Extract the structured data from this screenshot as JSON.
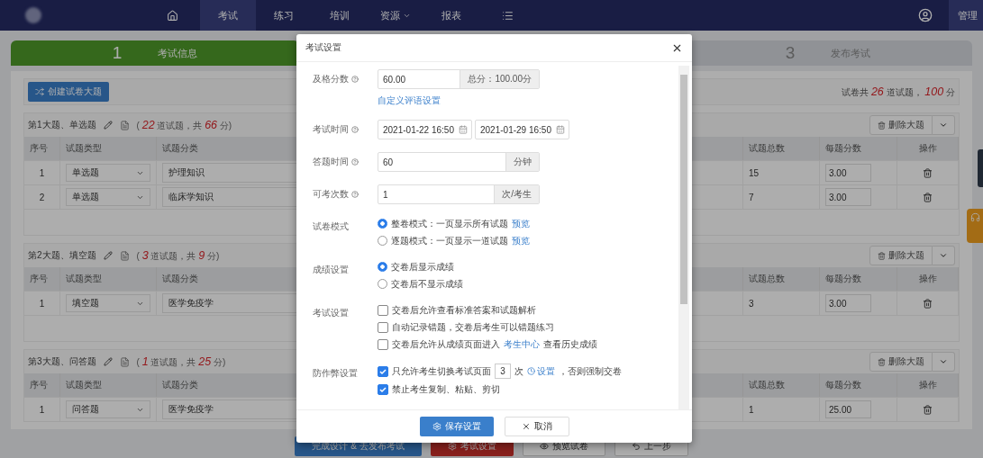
{
  "nav": {
    "items": [
      {
        "kind": "home",
        "selected": false
      },
      {
        "kind": "text",
        "label": "考试",
        "selected": true
      },
      {
        "kind": "text",
        "label": "练习",
        "selected": false
      },
      {
        "kind": "text",
        "label": "培训",
        "selected": false
      },
      {
        "kind": "dropdown",
        "label": "资源",
        "selected": false
      },
      {
        "kind": "text",
        "label": "报表",
        "selected": false
      },
      {
        "kind": "list",
        "selected": false
      }
    ],
    "user": "管理"
  },
  "steps": [
    {
      "number": "1",
      "label": "考试信息",
      "selected": true
    },
    {
      "number": "3",
      "label": "发布考试",
      "selected": false
    }
  ],
  "create_button": "创建试卷大题",
  "summary": {
    "prefix": "试卷共",
    "count": "26",
    "middle": "道试题，",
    "score": "100",
    "suffix": "分"
  },
  "sections": [
    {
      "title": "第1大题、单选题",
      "summary": {
        "prefix": "(",
        "count": "22",
        "middle": "道试题，共",
        "score": "66",
        "suffix": "分)"
      },
      "delete_label": "删除大题",
      "columns": [
        "序号",
        "试题类型",
        "试题分类",
        "试题总数",
        "每题分数",
        "操作"
      ],
      "rows": [
        {
          "index": "1",
          "type": "单选题",
          "category": "护理知识",
          "total": "15",
          "per_score": "3.00"
        },
        {
          "index": "2",
          "type": "单选题",
          "category": "临床学知识",
          "total": "7",
          "per_score": "3.00"
        }
      ]
    },
    {
      "title": "第2大题、填空题",
      "summary": {
        "prefix": "(",
        "count": "3",
        "middle": "道试题，共",
        "score": "9",
        "suffix": "分)"
      },
      "delete_label": "删除大题",
      "columns": [
        "序号",
        "试题类型",
        "试题分类",
        "试题总数",
        "每题分数",
        "操作"
      ],
      "rows": [
        {
          "index": "1",
          "type": "填空题",
          "category": "医学免疫学",
          "total": "3",
          "per_score": "3.00"
        }
      ]
    },
    {
      "title": "第3大题、问答题",
      "summary": {
        "prefix": "(",
        "count": "1",
        "middle": "道试题，共",
        "score": "25",
        "suffix": "分)"
      },
      "delete_label": "删除大题",
      "columns": [
        "序号",
        "试题类型",
        "试题分类",
        "试题总数",
        "每题分数",
        "操作"
      ],
      "rows": [
        {
          "index": "1",
          "type": "问答题",
          "category": "医学免疫学",
          "total": "1",
          "per_score": "25.00"
        }
      ]
    }
  ],
  "bottom_buttons": [
    {
      "kind": "primary",
      "label": "完成设计 & 去发布考试"
    },
    {
      "kind": "settings",
      "label": "考试设置"
    },
    {
      "kind": "preview",
      "label": "预览试卷"
    },
    {
      "kind": "back",
      "label": "上一步"
    }
  ],
  "modal": {
    "title": "考试设置",
    "fields": [
      {
        "kind": "addon",
        "label": "及格分数",
        "help": true,
        "value": "60.00",
        "addon": "总分：100.00分",
        "link": "自定义评语设置"
      },
      {
        "kind": "daterange",
        "label": "考试时间",
        "help": true,
        "start": "2021-01-22 16:50",
        "end": "2021-01-29 16:50"
      },
      {
        "kind": "addon",
        "label": "答题时间",
        "help": true,
        "value": "60",
        "addon": "分钟"
      },
      {
        "kind": "addon",
        "label": "可考次数",
        "help": true,
        "value": "1",
        "addon": "次/考生"
      },
      {
        "kind": "radio",
        "label": "试卷模式",
        "options": [
          {
            "selected": true,
            "parts": [
              {
                "kind": "text",
                "text": "整卷模式：一页显示所有试题"
              },
              {
                "kind": "link",
                "text": "预览"
              }
            ]
          },
          {
            "selected": false,
            "parts": [
              {
                "kind": "text",
                "text": "逐题模式：一页显示一道试题"
              },
              {
                "kind": "link",
                "text": "预览"
              }
            ]
          }
        ]
      },
      {
        "kind": "radio",
        "label": "成绩设置",
        "options": [
          {
            "selected": true,
            "parts": [
              {
                "kind": "text",
                "text": "交卷后显示成绩"
              }
            ]
          },
          {
            "selected": false,
            "parts": [
              {
                "kind": "text",
                "text": "交卷后不显示成绩"
              }
            ]
          }
        ]
      },
      {
        "kind": "checkbox",
        "label": "考试设置",
        "options": [
          {
            "checked": false,
            "parts": [
              {
                "kind": "text",
                "text": "交卷后允许查看标准答案和试题解析"
              }
            ]
          },
          {
            "checked": false,
            "parts": [
              {
                "kind": "text",
                "text": "自动记录错题，交卷后考生可以错题练习"
              }
            ]
          },
          {
            "checked": false,
            "parts": [
              {
                "kind": "text",
                "text": "交卷后允许从成绩页面进入"
              },
              {
                "kind": "link",
                "text": "考生中心"
              },
              {
                "kind": "text",
                "text": "查看历史成绩"
              }
            ]
          }
        ]
      },
      {
        "kind": "checkbox",
        "label": "防作弊设置",
        "options": [
          {
            "checked": true,
            "parts": [
              {
                "kind": "text",
                "text": "只允许考生切换考试页面"
              },
              {
                "kind": "input",
                "text": "3"
              },
              {
                "kind": "text",
                "text": "次"
              },
              {
                "kind": "setting",
                "text": "设置"
              },
              {
                "kind": "text",
                "text": "，否则强制交卷"
              }
            ]
          },
          {
            "checked": true,
            "parts": [
              {
                "kind": "text",
                "text": "禁止考生复制、粘贴、剪切"
              }
            ]
          }
        ]
      }
    ],
    "save": "保存设置",
    "cancel": "取消"
  }
}
